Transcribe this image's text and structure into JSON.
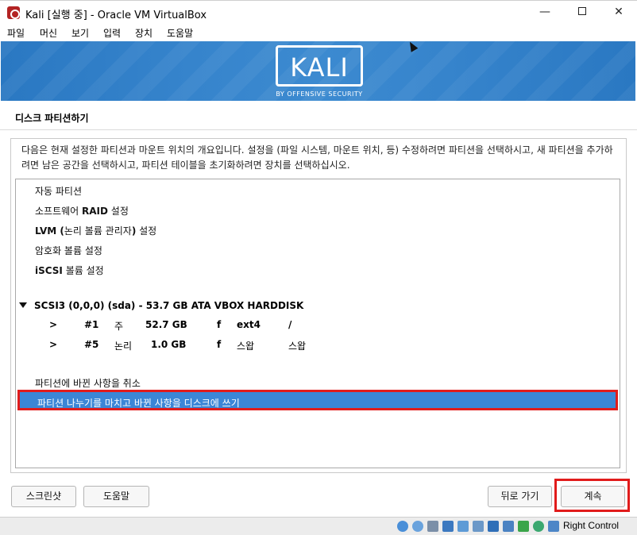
{
  "window": {
    "title": "Kali [실행 중] - Oracle VM VirtualBox",
    "minimize": "—",
    "close": "✕"
  },
  "menu": [
    "파일",
    "머신",
    "보기",
    "입력",
    "장치",
    "도움말"
  ],
  "banner": {
    "logo_text": "KALI",
    "logo_sub": "BY OFFENSIVE SECURITY"
  },
  "page": {
    "title": "디스크 파티션하기",
    "instruction": "다음은 현재 설정한 파티션과 마운트 위치의 개요입니다. 설정을 (파일 시스템, 마운트 위치, 등) 수정하려면 파티션을 선택하시고, 새 파티션을 추가하려면 남은 공간을 선택하시고, 파티션 테이블을 초기화하려면 장치를 선택하십시오."
  },
  "list": {
    "auto_partition": "자동 파티션",
    "raid_pre": "소프트웨어 ",
    "raid_bold": "RAID",
    "raid_post": " 설정",
    "lvm_bold": "LVM (",
    "lvm_mid": "논리 볼륨 관리자",
    "lvm_bold2": ")",
    "lvm_post": " 설정",
    "encrypt": "암호화 볼륨 설정",
    "iscsi_bold": "iSCSI",
    "iscsi_post": " 볼륨 설정",
    "disk": "SCSI3 (0,0,0) (sda) - 53.7 GB ATA VBOX HARDDISK",
    "partitions": [
      {
        "arrow": ">",
        "num": "#1",
        "type": "주",
        "size": "52.7 GB",
        "flag": "f",
        "fs": "ext4",
        "mount": "/"
      },
      {
        "arrow": ">",
        "num": "#5",
        "type": "논리",
        "size": "1.0 GB",
        "flag": "f",
        "fs": "스왑",
        "mount": "스왑"
      }
    ],
    "undo": "파티션에 바뀐 사항을 취소",
    "finish": "파티션 나누기를 마치고 바뀐 사항을 디스크에 쓰기"
  },
  "buttons": {
    "screenshot": "스크린샷",
    "help": "도움말",
    "back": "뒤로 가기",
    "continue": "계속"
  },
  "status": {
    "host_key": "Right Control"
  },
  "colors": {
    "banner": "#3684cc",
    "selection": "#3b86d6",
    "highlight": "#e11c1c"
  }
}
